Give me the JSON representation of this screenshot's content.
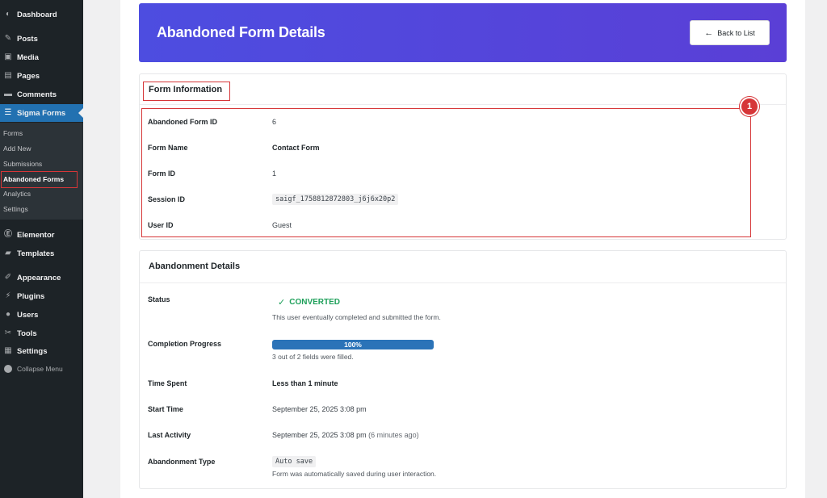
{
  "sidebar": {
    "items": [
      {
        "label": "Dashboard",
        "icon": "dashboard-icon"
      },
      {
        "label": "Posts",
        "icon": "pin-icon"
      },
      {
        "label": "Media",
        "icon": "media-icon"
      },
      {
        "label": "Pages",
        "icon": "page-icon"
      },
      {
        "label": "Comments",
        "icon": "comment-icon"
      },
      {
        "label": "Sigma Forms",
        "icon": "form-icon"
      },
      {
        "label": "Elementor",
        "icon": "elementor-icon"
      },
      {
        "label": "Templates",
        "icon": "folder-icon"
      },
      {
        "label": "Appearance",
        "icon": "brush-icon"
      },
      {
        "label": "Plugins",
        "icon": "plug-icon"
      },
      {
        "label": "Users",
        "icon": "user-icon"
      },
      {
        "label": "Tools",
        "icon": "wrench-icon"
      },
      {
        "label": "Settings",
        "icon": "settings-icon"
      }
    ],
    "submenu": [
      "Forms",
      "Add New",
      "Submissions",
      "Abandoned Forms",
      "Analytics",
      "Settings"
    ],
    "collapse_label": "Collapse Menu"
  },
  "header": {
    "title": "Abandoned Form Details",
    "back_label": "Back to List"
  },
  "form_info": {
    "title": "Form Information",
    "badge": "1",
    "rows": [
      {
        "label": "Abandoned Form ID",
        "value": "6"
      },
      {
        "label": "Form Name",
        "value": "Contact Form"
      },
      {
        "label": "Form ID",
        "value": "1"
      },
      {
        "label": "Session ID",
        "value": "saigf_1758812872803_j6j6x20p2"
      },
      {
        "label": "User ID",
        "value": "Guest"
      }
    ]
  },
  "details": {
    "title": "Abandonment Details",
    "status_label": "Status",
    "status_value": "CONVERTED",
    "status_note": "This user eventually completed and submitted the form.",
    "status_color": "#1ea05a",
    "progress_label": "Completion Progress",
    "progress_value": 100,
    "progress_text": "100%",
    "progress_note": "3 out of 2 fields were filled.",
    "time_spent_label": "Time Spent",
    "time_spent_value": "Less than 1 minute",
    "start_label": "Start Time",
    "start_value": "September 25, 2025 3:08 pm",
    "last_label": "Last Activity",
    "last_value": "September 25, 2025 3:08 pm",
    "last_ago": "(6 minutes ago)",
    "type_label": "Abandonment Type",
    "type_value": "Auto save",
    "type_note": "Form was automatically saved during user interaction."
  },
  "colors": {
    "accent": "#2271b1",
    "banner": "#4d4de0",
    "highlight": "#d63638"
  }
}
